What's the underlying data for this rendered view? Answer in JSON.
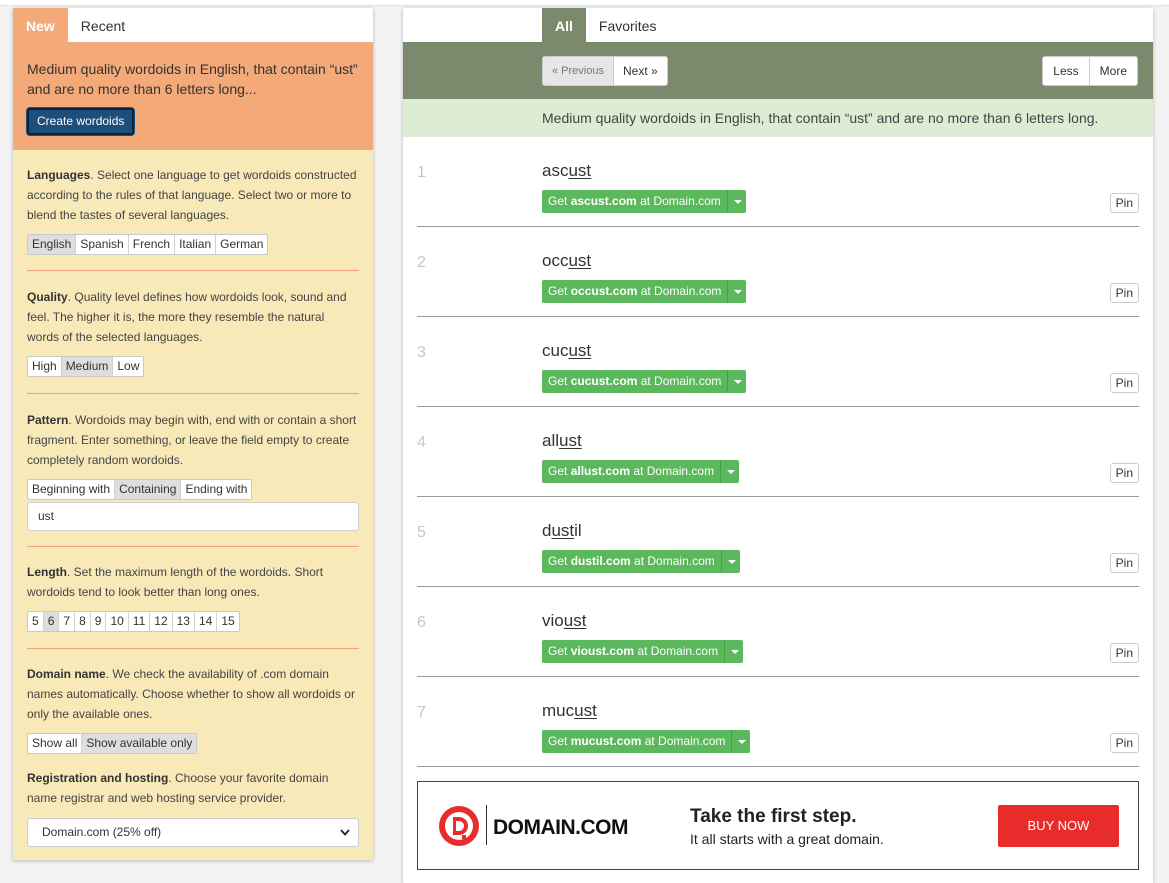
{
  "left": {
    "tabs": [
      "New",
      "Recent"
    ],
    "header_text": "Medium quality wordoids in English, that contain “ust” and are no more than 6 letters long...",
    "create_button": "Create wordoids",
    "languages": {
      "title": "Languages",
      "text": ". Select one language to get wordoids constructed according to the rules of that language. Select two or more to blend the tastes of several languages.",
      "options": [
        "English",
        "Spanish",
        "French",
        "Italian",
        "German"
      ]
    },
    "quality": {
      "title": "Quality",
      "text": ". Quality level defines how wordoids look, sound and feel. The higher it is, the more they resemble the natural words of the selected languages.",
      "options": [
        "High",
        "Medium",
        "Low"
      ]
    },
    "pattern": {
      "title": "Pattern",
      "text": ". Wordoids may begin with, end with or contain a short fragment. Enter something, or leave the field empty to create completely random wordoids.",
      "options": [
        "Beginning with",
        "Containing",
        "Ending with"
      ],
      "input_value": "ust"
    },
    "length": {
      "title": "Length",
      "text": ". Set the maximum length of the wordoids. Short wordoids tend to look better than long ones.",
      "options": [
        "5",
        "6",
        "7",
        "8",
        "9",
        "10",
        "11",
        "12",
        "13",
        "14",
        "15"
      ]
    },
    "domain": {
      "title": "Domain name",
      "text": ". We check the availability of .com domain names automatically. Choose whether to show all wordoids or only the available ones.",
      "options": [
        "Show all",
        "Show available only"
      ]
    },
    "registration": {
      "title": "Registration and hosting",
      "text": ". Choose your favorite domain name registrar and web hosting service provider.",
      "selected": "Domain.com (25% off)"
    }
  },
  "right": {
    "tabs": [
      "All",
      "Favorites"
    ],
    "prev_label": "« Previous",
    "next_label": "Next »",
    "less_label": "Less",
    "more_label": "More",
    "description": "Medium quality wordoids in English, that contain “ust” and are no more than 6 letters long.",
    "results": [
      {
        "num": "1",
        "pre": "asc",
        "frag": "ust",
        "post": "",
        "get": "Get",
        "domain": "ascust.com",
        "at": "at Domain.com",
        "pin": "Pin"
      },
      {
        "num": "2",
        "pre": "occ",
        "frag": "ust",
        "post": "",
        "get": "Get",
        "domain": "occust.com",
        "at": "at Domain.com",
        "pin": "Pin"
      },
      {
        "num": "3",
        "pre": "cuc",
        "frag": "ust",
        "post": "",
        "get": "Get",
        "domain": "cucust.com",
        "at": "at Domain.com",
        "pin": "Pin"
      },
      {
        "num": "4",
        "pre": "all",
        "frag": "ust",
        "post": "",
        "get": "Get",
        "domain": "allust.com",
        "at": "at Domain.com",
        "pin": "Pin"
      },
      {
        "num": "5",
        "pre": "d",
        "frag": "ust",
        "post": "il",
        "get": "Get",
        "domain": "dustil.com",
        "at": "at Domain.com",
        "pin": "Pin"
      },
      {
        "num": "6",
        "pre": "vio",
        "frag": "ust",
        "post": "",
        "get": "Get",
        "domain": "vioust.com",
        "at": "at Domain.com",
        "pin": "Pin"
      },
      {
        "num": "7",
        "pre": "muc",
        "frag": "ust",
        "post": "",
        "get": "Get",
        "domain": "mucust.com",
        "at": "at Domain.com",
        "pin": "Pin"
      }
    ],
    "ad": {
      "brand": "DOMAIN.COM",
      "headline": "Take the first step.",
      "subline": "It all starts with a great domain.",
      "button": "BUY NOW"
    }
  },
  "colors": {
    "orange": "#f3a978",
    "cream": "#f8e9b9",
    "olive": "#7b8a6d",
    "mint": "#dcedd4",
    "green": "#5cb85c",
    "navy": "#1e4f7a",
    "red": "#e82b2b"
  },
  "icons": {
    "dropdown": "chevron-down-icon",
    "caret": "caret-down-icon",
    "logo": "domain-logo-icon"
  }
}
